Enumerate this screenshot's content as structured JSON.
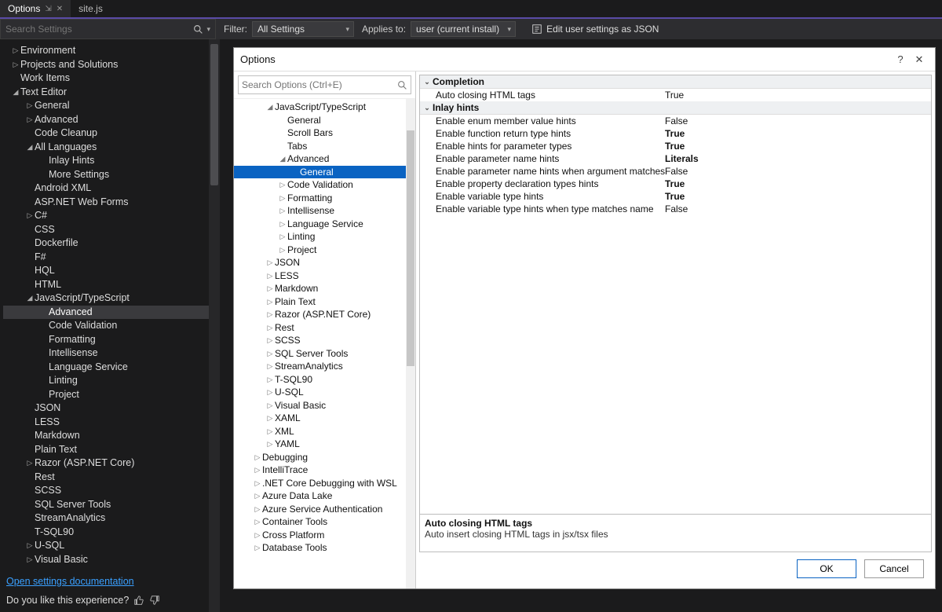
{
  "tabs": {
    "active": "Options",
    "pinned_glyph": "⇲",
    "close_glyph": "✕",
    "other": "site.js"
  },
  "toolbar": {
    "search_placeholder": "Search Settings",
    "filter_label": "Filter:",
    "filter_value": "All Settings",
    "applies_label": "Applies to:",
    "applies_value": "user (current install)",
    "json_link": "Edit user settings as JSON"
  },
  "dark_tree": [
    {
      "d": 0,
      "a": "▷",
      "t": "Environment"
    },
    {
      "d": 0,
      "a": "▷",
      "t": "Projects and Solutions"
    },
    {
      "d": 0,
      "a": "",
      "t": "Work Items"
    },
    {
      "d": 0,
      "a": "◢",
      "t": "Text Editor"
    },
    {
      "d": 1,
      "a": "▷",
      "t": "General"
    },
    {
      "d": 1,
      "a": "▷",
      "t": "Advanced"
    },
    {
      "d": 1,
      "a": "",
      "t": "Code Cleanup"
    },
    {
      "d": 1,
      "a": "◢",
      "t": "All Languages"
    },
    {
      "d": 2,
      "a": "",
      "t": "Inlay Hints"
    },
    {
      "d": 2,
      "a": "",
      "t": "More Settings"
    },
    {
      "d": 1,
      "a": "",
      "t": "Android XML"
    },
    {
      "d": 1,
      "a": "",
      "t": "ASP.NET Web Forms"
    },
    {
      "d": 1,
      "a": "▷",
      "t": "C#"
    },
    {
      "d": 1,
      "a": "",
      "t": "CSS"
    },
    {
      "d": 1,
      "a": "",
      "t": "Dockerfile"
    },
    {
      "d": 1,
      "a": "",
      "t": "F#"
    },
    {
      "d": 1,
      "a": "",
      "t": "HQL"
    },
    {
      "d": 1,
      "a": "",
      "t": "HTML"
    },
    {
      "d": 1,
      "a": "◢",
      "t": "JavaScript/TypeScript"
    },
    {
      "d": 2,
      "a": "",
      "t": "Advanced",
      "sel": true
    },
    {
      "d": 2,
      "a": "",
      "t": "Code Validation"
    },
    {
      "d": 2,
      "a": "",
      "t": "Formatting"
    },
    {
      "d": 2,
      "a": "",
      "t": "Intellisense"
    },
    {
      "d": 2,
      "a": "",
      "t": "Language Service"
    },
    {
      "d": 2,
      "a": "",
      "t": "Linting"
    },
    {
      "d": 2,
      "a": "",
      "t": "Project"
    },
    {
      "d": 1,
      "a": "",
      "t": "JSON"
    },
    {
      "d": 1,
      "a": "",
      "t": "LESS"
    },
    {
      "d": 1,
      "a": "",
      "t": "Markdown"
    },
    {
      "d": 1,
      "a": "",
      "t": "Plain Text"
    },
    {
      "d": 1,
      "a": "▷",
      "t": "Razor (ASP.NET Core)"
    },
    {
      "d": 1,
      "a": "",
      "t": "Rest"
    },
    {
      "d": 1,
      "a": "",
      "t": "SCSS"
    },
    {
      "d": 1,
      "a": "",
      "t": "SQL Server Tools"
    },
    {
      "d": 1,
      "a": "",
      "t": "StreamAnalytics"
    },
    {
      "d": 1,
      "a": "",
      "t": "T-SQL90"
    },
    {
      "d": 1,
      "a": "▷",
      "t": "U-SQL"
    },
    {
      "d": 1,
      "a": "▷",
      "t": "Visual Basic"
    }
  ],
  "bottom": {
    "doc_link": "Open settings documentation",
    "feedback": "Do you like this experience?"
  },
  "dialog": {
    "title": "Options",
    "help": "?",
    "close": "✕",
    "search_placeholder": "Search Options (Ctrl+E)",
    "tree": [
      {
        "d": 0,
        "a": "◢",
        "t": "JavaScript/TypeScript"
      },
      {
        "d": 1,
        "a": "",
        "t": "General"
      },
      {
        "d": 1,
        "a": "",
        "t": "Scroll Bars"
      },
      {
        "d": 1,
        "a": "",
        "t": "Tabs"
      },
      {
        "d": 1,
        "a": "◢",
        "t": "Advanced"
      },
      {
        "d": 2,
        "a": "",
        "t": "General",
        "sel": true
      },
      {
        "d": 1,
        "a": "▷",
        "t": "Code Validation"
      },
      {
        "d": 1,
        "a": "▷",
        "t": "Formatting"
      },
      {
        "d": 1,
        "a": "▷",
        "t": "Intellisense"
      },
      {
        "d": 1,
        "a": "▷",
        "t": "Language Service"
      },
      {
        "d": 1,
        "a": "▷",
        "t": "Linting"
      },
      {
        "d": 1,
        "a": "▷",
        "t": "Project"
      },
      {
        "d": 0,
        "a": "▷",
        "t": "JSON"
      },
      {
        "d": 0,
        "a": "▷",
        "t": "LESS"
      },
      {
        "d": 0,
        "a": "▷",
        "t": "Markdown"
      },
      {
        "d": 0,
        "a": "▷",
        "t": "Plain Text"
      },
      {
        "d": 0,
        "a": "▷",
        "t": "Razor (ASP.NET Core)"
      },
      {
        "d": 0,
        "a": "▷",
        "t": "Rest"
      },
      {
        "d": 0,
        "a": "▷",
        "t": "SCSS"
      },
      {
        "d": 0,
        "a": "▷",
        "t": "SQL Server Tools"
      },
      {
        "d": 0,
        "a": "▷",
        "t": "StreamAnalytics"
      },
      {
        "d": 0,
        "a": "▷",
        "t": "T-SQL90"
      },
      {
        "d": 0,
        "a": "▷",
        "t": "U-SQL"
      },
      {
        "d": 0,
        "a": "▷",
        "t": "Visual Basic"
      },
      {
        "d": 0,
        "a": "▷",
        "t": "XAML"
      },
      {
        "d": 0,
        "a": "▷",
        "t": "XML"
      },
      {
        "d": 0,
        "a": "▷",
        "t": "YAML"
      },
      {
        "d": -1,
        "a": "▷",
        "t": "Debugging"
      },
      {
        "d": -1,
        "a": "▷",
        "t": "IntelliTrace"
      },
      {
        "d": -1,
        "a": "▷",
        "t": ".NET Core Debugging with WSL"
      },
      {
        "d": -1,
        "a": "▷",
        "t": "Azure Data Lake"
      },
      {
        "d": -1,
        "a": "▷",
        "t": "Azure Service Authentication"
      },
      {
        "d": -1,
        "a": "▷",
        "t": "Container Tools"
      },
      {
        "d": -1,
        "a": "▷",
        "t": "Cross Platform"
      },
      {
        "d": -1,
        "a": "▷",
        "t": "Database Tools"
      }
    ],
    "groups": [
      {
        "name": "Completion",
        "rows": [
          {
            "n": "Auto closing HTML tags",
            "v": "True",
            "b": false
          }
        ]
      },
      {
        "name": "Inlay hints",
        "rows": [
          {
            "n": "Enable enum member value hints",
            "v": "False",
            "b": false
          },
          {
            "n": "Enable function return type hints",
            "v": "True",
            "b": true
          },
          {
            "n": "Enable hints for parameter types",
            "v": "True",
            "b": true
          },
          {
            "n": "Enable parameter name hints",
            "v": "Literals",
            "b": true
          },
          {
            "n": "Enable parameter name hints when argument matches nam",
            "v": "False",
            "b": false
          },
          {
            "n": "Enable property declaration types hints",
            "v": "True",
            "b": true
          },
          {
            "n": "Enable variable type hints",
            "v": "True",
            "b": true
          },
          {
            "n": "Enable variable type hints when type matches name",
            "v": "False",
            "b": false
          }
        ]
      }
    ],
    "desc": {
      "title": "Auto closing HTML tags",
      "text": "Auto insert closing HTML tags in jsx/tsx files"
    },
    "ok": "OK",
    "cancel": "Cancel"
  }
}
